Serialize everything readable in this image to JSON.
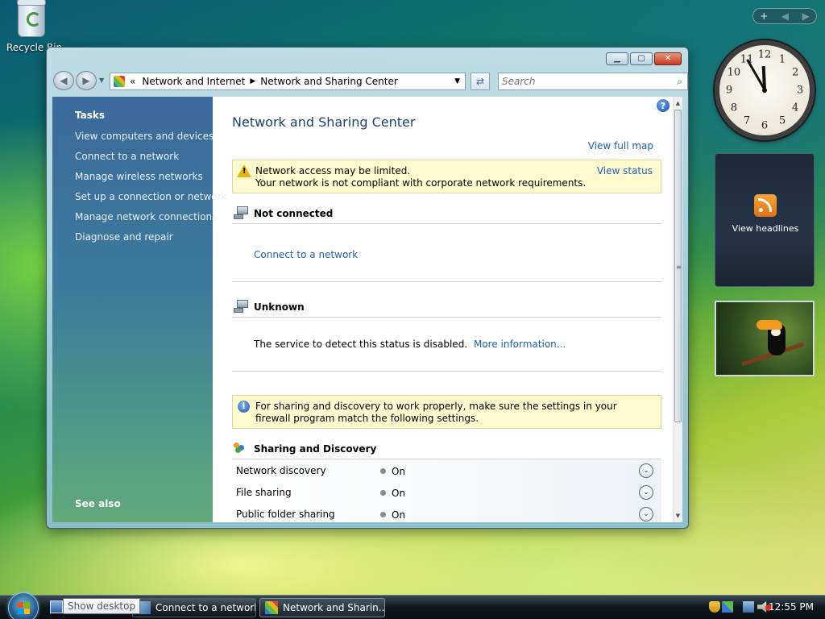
{
  "desktop": {
    "recycle_bin_label": "Recycle Bin"
  },
  "window": {
    "controls": {
      "minimize": "▁",
      "maximize": "▢",
      "close": "✕"
    },
    "nav": {
      "back": "◀",
      "forward": "▶",
      "history_dd": "▼"
    },
    "address": {
      "prefix": "«",
      "crumbs": [
        "Network and Internet",
        "Network and Sharing Center"
      ],
      "crumb_sep": "▶",
      "dropdown": "▼"
    },
    "refresh_glyph": "⇄",
    "search": {
      "placeholder": "Search",
      "icon_glyph": "⌕"
    }
  },
  "sidebar": {
    "tasks_title": "Tasks",
    "items": [
      {
        "label": "View computers and devices"
      },
      {
        "label": "Connect to a network"
      },
      {
        "label": "Manage wireless networks"
      },
      {
        "label": "Set up a connection or network"
      },
      {
        "label": "Manage network connections"
      },
      {
        "label": "Diagnose and repair"
      }
    ],
    "see_also": "See also"
  },
  "content": {
    "help_glyph": "?",
    "title": "Network and Sharing Center",
    "view_full_map": "View full map",
    "warning": {
      "glyph": "!",
      "line1": "Network access may be limited.",
      "line2": "Your network is not compliant with corporate network requirements.",
      "link": "View status"
    },
    "not_connected": {
      "title": "Not connected",
      "link": "Connect to a network"
    },
    "unknown": {
      "title": "Unknown",
      "text": "The service to detect this status is disabled.",
      "link": "More information..."
    },
    "info": {
      "glyph": "i",
      "text": "For sharing and discovery to work properly, make sure the settings in your firewall program match the following settings."
    },
    "sharing": {
      "title": "Sharing and Discovery",
      "expand_glyph": "⌄",
      "rows": [
        {
          "name": "Network discovery",
          "state": "On"
        },
        {
          "name": "File sharing",
          "state": "On"
        },
        {
          "name": "Public folder sharing",
          "state": "On"
        }
      ]
    },
    "scroll": {
      "up": "▲",
      "down": "▼",
      "grip": "≡"
    }
  },
  "gadgets": {
    "sidebar_controls": {
      "add": "+",
      "prev": "◀",
      "next": "▶"
    },
    "clock": {
      "numerals": [
        "12",
        "1",
        "2",
        "3",
        "4",
        "5",
        "6",
        "7",
        "8",
        "9",
        "10",
        "11"
      ],
      "hour": 11,
      "minute": 55
    },
    "feed": {
      "label": "View headlines"
    }
  },
  "taskbar": {
    "tooltip": "Show desktop",
    "buttons": [
      {
        "label": "Connect to a network",
        "active": false
      },
      {
        "label": "Network and Sharin...",
        "active": true
      }
    ],
    "time": "12:55 PM"
  },
  "colors": {
    "link": "#1e5fb3",
    "title": "#1e3f78",
    "notice_bg": "#fffbd0"
  }
}
